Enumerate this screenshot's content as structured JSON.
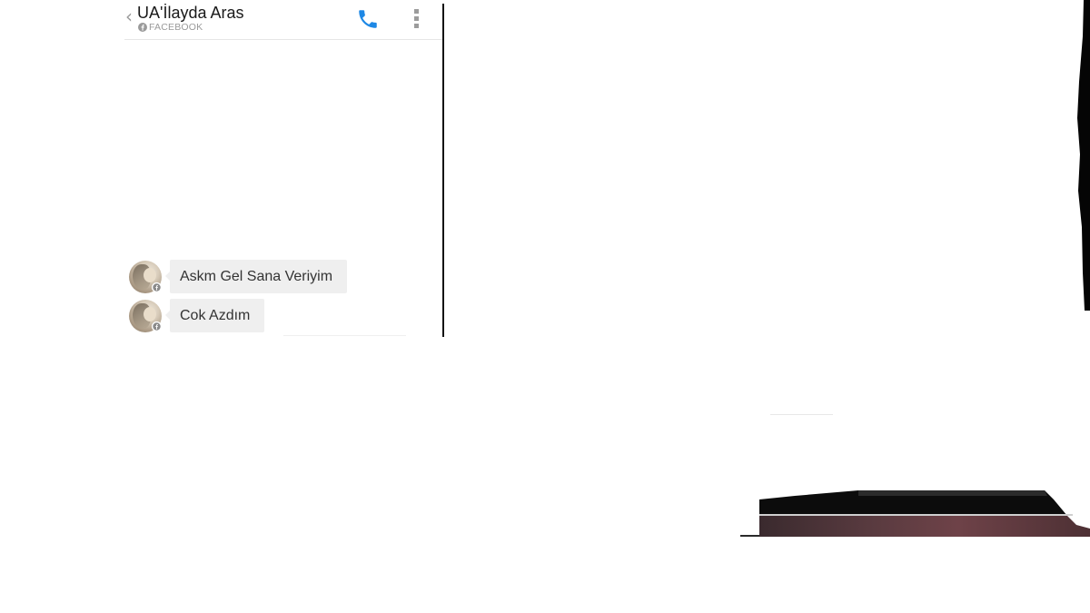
{
  "header": {
    "back_icon": "chevron-left-icon",
    "contact_name": "UA'İlayda Aras",
    "source_icon": "facebook-icon",
    "source_label": "FACEBOOK",
    "call_icon": "phone-icon",
    "more_icon": "more-vertical-icon"
  },
  "messages": [
    {
      "text": "Askm Gel Sana Veriyim",
      "avatar_icon": "avatar",
      "badge_icon": "facebook-badge-icon"
    },
    {
      "text": "Cok Azdım",
      "avatar_icon": "avatar",
      "badge_icon": "facebook-badge-icon"
    }
  ],
  "colors": {
    "accent": "#1e88e5",
    "bubble": "#efefef",
    "muted_text": "#9a9a9a",
    "divider": "#111111"
  }
}
